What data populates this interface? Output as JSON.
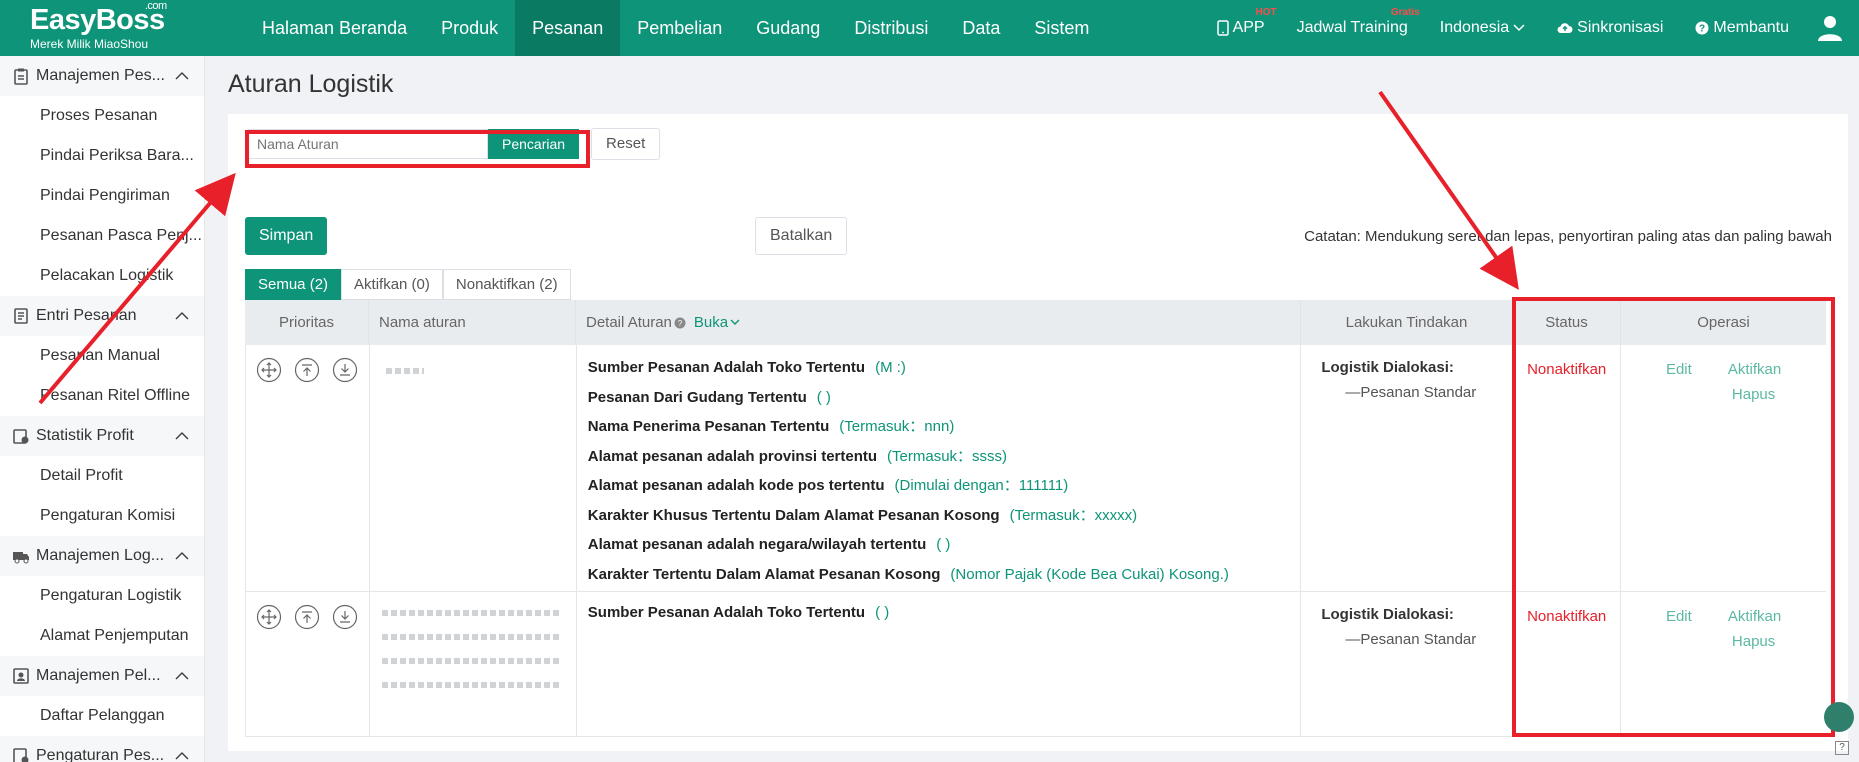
{
  "topbar": {
    "brand": "EasyBoss",
    "brand_suffix": ".com",
    "tagline": "Merek Milik MiaoShou",
    "nav": [
      "Halaman Beranda",
      "Produk",
      "Pesanan",
      "Pembelian",
      "Gudang",
      "Distribusi",
      "Data",
      "Sistem"
    ],
    "active_nav": "Pesanan",
    "app_label": "APP",
    "app_badge": "HOT",
    "training_label": "Jadwal Training",
    "training_badge": "Gratis",
    "language": "Indonesia",
    "sync_label": "Sinkronisasi",
    "help_label": "Membantu"
  },
  "sidebar": {
    "groups": [
      {
        "label": "Manajemen Pes...",
        "items": [
          "Proses Pesanan",
          "Pindai Periksa Bara...",
          "Pindai Pengiriman",
          "Pesanan Pasca Penj...",
          "Pelacakan Logistik"
        ]
      },
      {
        "label": "Entri Pesanan",
        "items": [
          "Pesanan Manual",
          "Pesanan Ritel Offline"
        ]
      },
      {
        "label": "Statistik Profit",
        "items": [
          "Detail Profit",
          "Pengaturan Komisi"
        ]
      },
      {
        "label": "Manajemen Log...",
        "items": [
          "Pengaturan Logistik",
          "Alamat Penjemputan"
        ]
      },
      {
        "label": "Manajemen Pel...",
        "items": [
          "Daftar Pelanggan"
        ]
      },
      {
        "label": "Pengaturan Pes...",
        "items": []
      }
    ]
  },
  "page": {
    "title": "Aturan Logistik",
    "search_placeholder": "Nama Aturan",
    "search_button": "Pencarian",
    "reset_button": "Reset",
    "save_button": "Simpan",
    "cancel_button": "Batalkan",
    "note": "Catatan: Mendukung seret dan lepas, penyortiran paling atas dan paling bawah",
    "tabs": [
      "Semua (2)",
      "Aktifkan (0)",
      "Nonaktifkan (2)"
    ],
    "active_tab": "Semua (2)"
  },
  "table": {
    "headers": {
      "priority": "Prioritas",
      "name": "Nama aturan",
      "detail": "Detail Aturan",
      "detail_toggle": "Buka",
      "action": "Lakukan Tindakan",
      "status": "Status",
      "operation": "Operasi"
    },
    "rows": [
      {
        "rules": [
          {
            "label": "Sumber Pesanan Adalah Toko Tertentu",
            "value": "(M                  :)"
          },
          {
            "label": "Pesanan Dari Gudang Tertentu",
            "value": "(              )"
          },
          {
            "label": "Nama Penerima Pesanan Tertentu",
            "value": "(Termasuk：nnn)"
          },
          {
            "label": "Alamat pesanan adalah provinsi tertentu",
            "value": "(Termasuk：ssss)"
          },
          {
            "label": "Alamat pesanan adalah kode pos tertentu",
            "value": "(Dimulai dengan：111111)"
          },
          {
            "label": "Karakter Khusus Tertentu Dalam Alamat Pesanan Kosong",
            "value": "(Termasuk：xxxxx)"
          },
          {
            "label": "Alamat pesanan adalah negara/wilayah tertentu",
            "value": "(              )"
          },
          {
            "label": "Karakter Tertentu Dalam Alamat Pesanan Kosong",
            "value": "(Nomor Pajak (Kode Bea Cukai) Kosong.)"
          }
        ],
        "action_title": "Logistik Dialokasi:",
        "action_value": "—Pesanan Standar",
        "status": "Nonaktifkan",
        "ops": [
          "Edit",
          "Aktifkan",
          "Hapus"
        ]
      },
      {
        "rules": [
          {
            "label": "Sumber Pesanan Adalah Toko Tertentu",
            "value": "(              )"
          }
        ],
        "action_title": "Logistik Dialokasi:",
        "action_value": "—Pesanan Standar",
        "status": "Nonaktifkan",
        "ops": [
          "Edit",
          "Aktifkan",
          "Hapus"
        ]
      }
    ]
  },
  "colors": {
    "brand": "#0e9478",
    "highlight": "#e8202a",
    "status_inactive": "#e8202a"
  }
}
